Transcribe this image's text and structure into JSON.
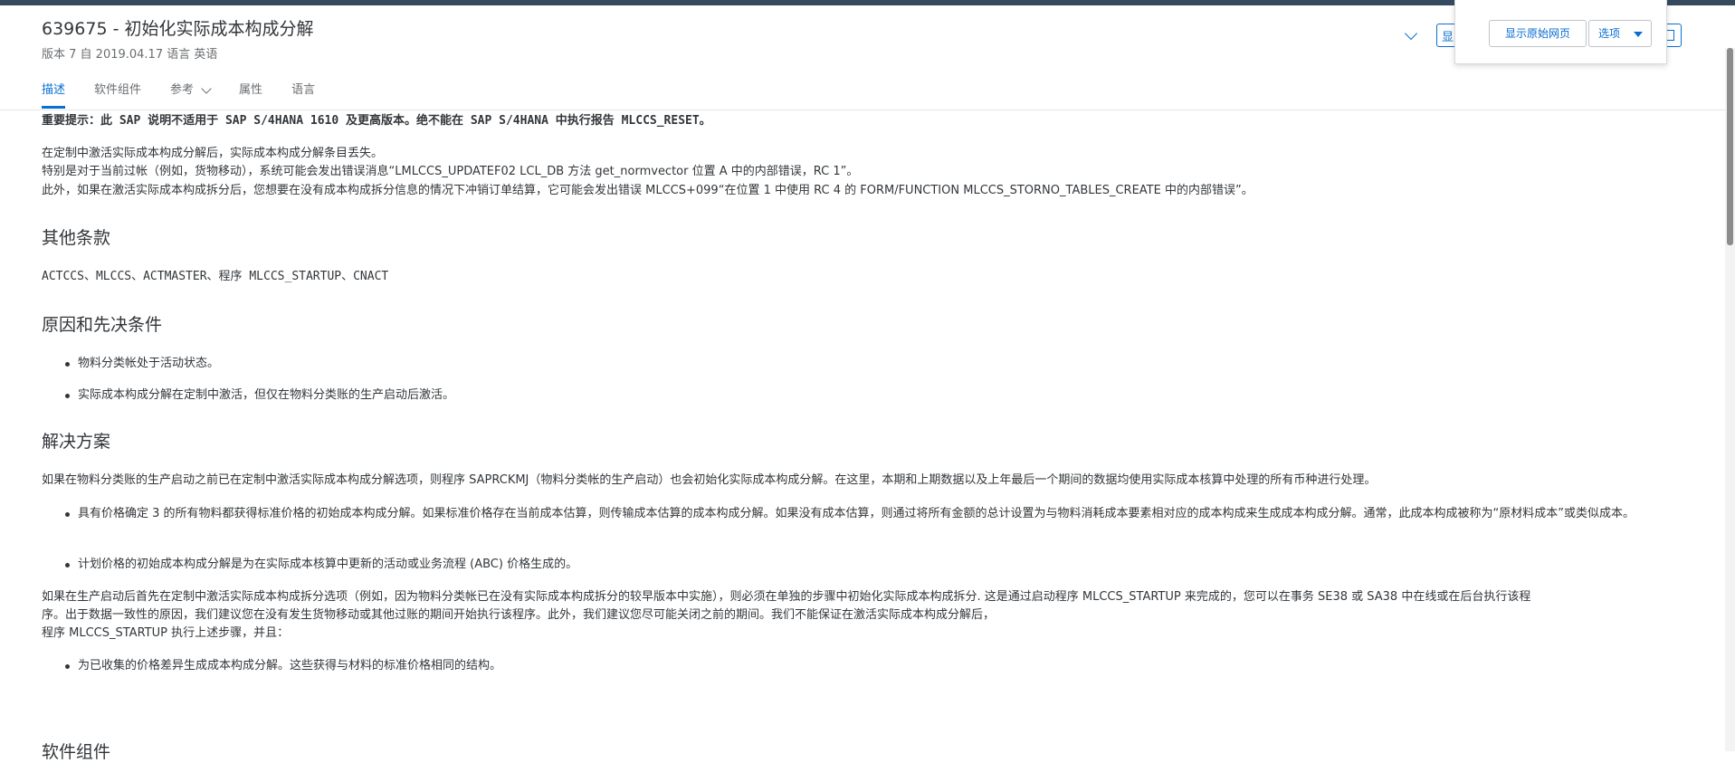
{
  "header": {
    "title": "639675 - 初始化实际成本构成分解",
    "subtitle": "版本 7 自 2019.04.17 语言 英语",
    "left_button_partial": "显",
    "popover": {
      "show_original_label": "显示原始网页",
      "options_label": "选项"
    }
  },
  "tabs": [
    {
      "label": "描述",
      "active": true
    },
    {
      "label": "软件组件"
    },
    {
      "label": "参考"
    },
    {
      "label": "属性"
    },
    {
      "label": "语言"
    }
  ],
  "content": {
    "warning": "重要提示：此 SAP 说明不适用于 SAP S/4HANA 1610 及更高版本。绝不能在 SAP S/4HANA 中执行报告 MLCCS_RESET。",
    "symptom_lines": [
      "在定制中激活实际成本构成分解后，实际成本构成分解条目丢失。",
      "特别是对于当前过帐（例如，货物移动），系统可能会发出错误消息“LMLCCS_UPDATEF02 LCL_DB 方法 get_normvector 位置 A 中的内部错误，RC 1”。",
      "此外，如果在激活实际成本构成拆分后，您想要在没有成本构成拆分信息的情况下冲销订单结算，它可能会发出错误 MLCCS+099“在位置 1 中使用 RC 4 的 FORM/FUNCTION MLCCS_STORNO_TABLES_CREATE 中的内部错误”。"
    ],
    "other_terms_heading": "其他条款",
    "other_terms": "ACTCCS、MLCCS、ACTMASTER、程序 MLCCS_STARTUP、CNACT",
    "reason_heading": "原因和先决条件",
    "reason_items": [
      "物料分类帐处于活动状态。",
      "实际成本构成分解在定制中激活，但仅在物料分类账的生产启动后激活。"
    ],
    "solution_heading": "解决方案",
    "solution_intro": "如果在物料分类账的生产启动之前已在定制中激活实际成本构成分解选项，则程序 SAPRCKMJ（物料分类帐的生产启动）也会初始化实际成本构成分解。在这里，本期和上期数据以及上年最后一个期间的数据均使用实际成本核算中处理的所有币种进行处理。",
    "solution_items": [
      "具有价格确定 3 的所有物料都获得标准价格的初始成本构成分解。如果标准价格存在当前成本估算，则传输成本估算的成本构成分解。如果没有成本估算，则通过将所有金额的总计设置为与物料消耗成本要素相对应的成本构成来生成成本构成分解。通常，此成本构成被称为“原材料成本”或类似成本。",
      "计划价格的初始成本构成分解是为在实际成本核算中更新的活动或业务流程 (ABC) 价格生成的。"
    ],
    "startup_para": [
      "如果在生产启动后首先在定制中激活实际成本构成拆分选项（例如，因为物料分类帐已在没有实际成本构成拆分的较早版本中实施），则必须在单独的步骤中初始化实际成本构成拆分. 这是通过启动程序 MLCCS_STARTUP 来完成的，您可以在事务 SE38 或 SA38 中在线或在后台执行该程",
      "序。出于数据一致性的原因，我们建议您在没有发生货物移动或其他过账的期间开始执行该程序。此外，我们建议您尽可能关闭之前的期间。我们不能保证在激活实际成本构成分解后，",
      "程序 MLCCS_STARTUP 执行上述步骤，并且："
    ],
    "startup_items": [
      "为已收集的价格差异生成成本构成分解。这些获得与材料的标准价格相同的结构。"
    ],
    "next_heading": "软件组件"
  }
}
